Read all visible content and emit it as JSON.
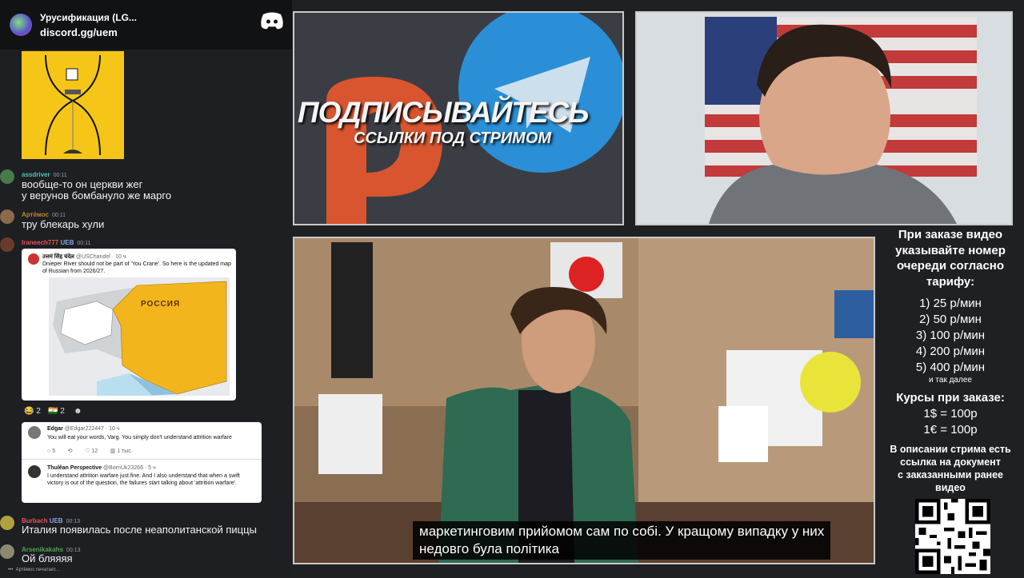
{
  "server": {
    "name": "Урусификация (LG...",
    "invite": "discord.gg/uem"
  },
  "chat": {
    "messages": [
      {
        "user": "assdriver",
        "time": "00:11",
        "color": "#4fc3c3",
        "lines": [
          "вообще-то он церкви жег",
          "у верунов бомбануло же марго"
        ]
      },
      {
        "user": "Артёмос",
        "time": "00:11",
        "color": "#c0862e",
        "lines": [
          "тру блекарь хули"
        ]
      },
      {
        "user": "Iraneech777",
        "badge": "UEB",
        "time": "00:11",
        "color": "#e35656",
        "lines": []
      },
      {
        "user": "Burbach",
        "badge": "UEB",
        "time": "00:13",
        "color": "#e35656",
        "lines": [
          "Италия появилась после неаполитанской пиццы"
        ]
      },
      {
        "user": "Arsenikakahs",
        "time": "00:13",
        "color": "#4fa34f",
        "lines": [
          "Ой бляяяя"
        ]
      }
    ],
    "typing": "Артёмос печатает...",
    "reactions": [
      {
        "emoji": "😂",
        "count": "2"
      },
      {
        "emoji": "🇮🇳",
        "count": "2"
      }
    ],
    "tweet1": {
      "author": "उत्तमं सिंह चंदेल",
      "handle": "@USChandel · 10 ч",
      "text": "Dnieper River should not be part of 'You Crane'. So here is the updated map of Russian from 2026/27.",
      "map_label": "РОССИЯ"
    },
    "tweet2": {
      "author": "Edgar",
      "handle": "@Edgar222447 · 10 ч",
      "text": "You will eat your words, Varg. You simply don't understand attrition warfare",
      "stats": [
        "5",
        "12",
        "1 тыс."
      ],
      "reply_author": "Thulêan Perspective",
      "reply_handle": "@BornUk23266 · 5 ч",
      "reply_text": "I understand attrition warfare just fine. And I also understand that when a swift victory is out of the question, the failures start talking about 'attrition warfare'."
    }
  },
  "promo": {
    "title": "ПОДПИСЫВАЙТЕСЬ",
    "subtitle": "ССЫЛКИ ПОД СТРИМОМ"
  },
  "video": {
    "subtitle_line1": "маркетинговим прийомом сам по собі. У кращому випадку у них",
    "subtitle_line2": "недовго була політика"
  },
  "info": {
    "heading": [
      "При заказе видео",
      "указывайте номер",
      "очереди согласно",
      "тарифу:"
    ],
    "prices": [
      "1) 25 р/мин",
      "2) 50 р/мин",
      "3) 100 р/мин",
      "4) 200 р/мин",
      "5) 400 р/мин"
    ],
    "etc": "и так далее",
    "rates_heading": "Курсы при заказе:",
    "rates": [
      "1$ = 100р",
      "1€ = 100р"
    ],
    "description": [
      "В описании стрима есть",
      "ссылка на документ",
      "с заказанными ранее",
      "видео"
    ]
  },
  "colors": {
    "accent_orange": "#d9552f",
    "telegram_blue": "#2a8fd6",
    "hourglass_yellow": "#f5c518"
  }
}
